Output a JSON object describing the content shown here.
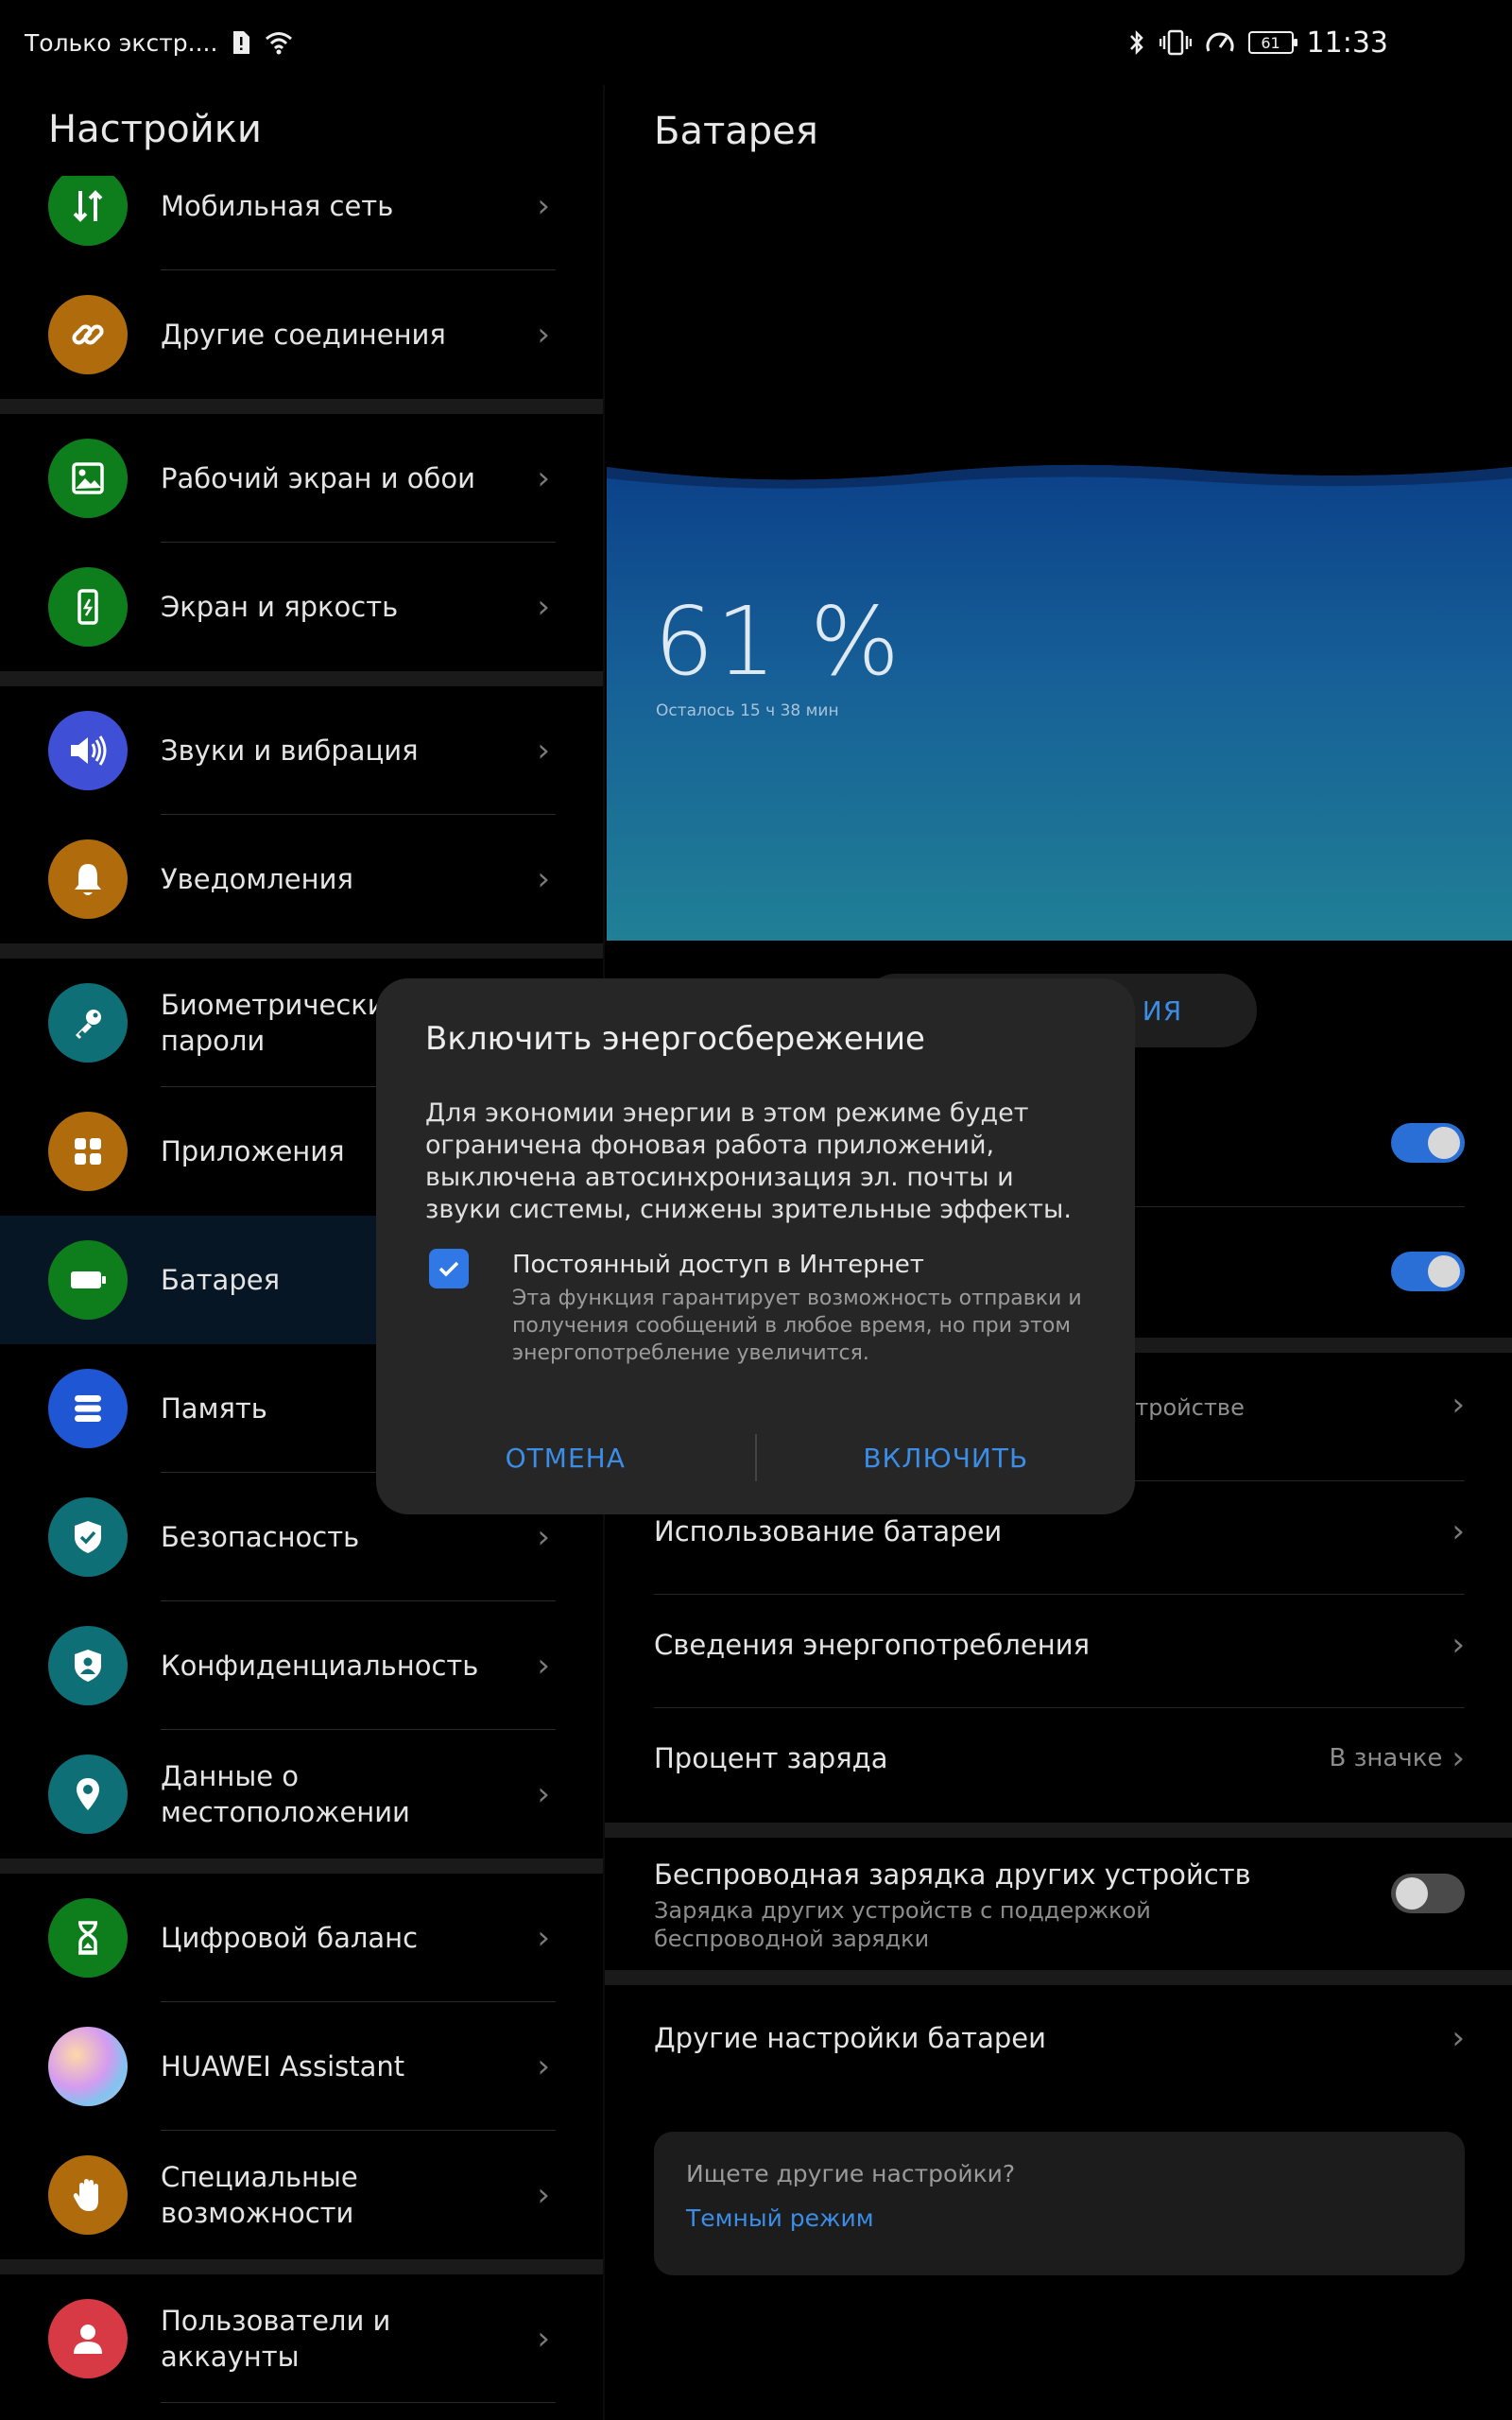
{
  "status": {
    "left_text": "Только экстр....",
    "time": "11:33",
    "battery_level": "61"
  },
  "settings": {
    "title": "Настройки",
    "items": [
      {
        "label": "Мобильная сеть",
        "icon": "mobile-data-icon",
        "color": "#0e7d1c"
      },
      {
        "label": "Другие соединения",
        "icon": "link-icon",
        "color": "#b06b0c"
      },
      {
        "label": "Рабочий экран и обои",
        "icon": "wallpaper-icon",
        "color": "#0e7d1c"
      },
      {
        "label": "Экран и яркость",
        "icon": "display-icon",
        "color": "#0e7d1c"
      },
      {
        "label": "Звуки и вибрация",
        "icon": "speaker-icon",
        "color": "#3f4fd6"
      },
      {
        "label": "Уведомления",
        "icon": "bell-icon",
        "color": "#b06b0c"
      },
      {
        "label": "Биометрические данные и пароли",
        "label_line1": "Биометрические",
        "label_line2": "пароли",
        "icon": "key-icon",
        "color": "#0f6f76"
      },
      {
        "label": "Приложения",
        "icon": "apps-grid-icon",
        "color": "#b06b0c"
      },
      {
        "label": "Батарея",
        "icon": "battery-icon",
        "color": "#0e7d1c"
      },
      {
        "label": "Память",
        "icon": "storage-icon",
        "color": "#1f56d4"
      },
      {
        "label": "Безопасность",
        "icon": "shield-check-icon",
        "color": "#0f6f76"
      },
      {
        "label": "Конфиденциальность",
        "icon": "privacy-shield-icon",
        "color": "#0f6f76"
      },
      {
        "label_line1": "Данные о",
        "label_line2": "местоположении",
        "icon": "location-pin-icon",
        "color": "#0f6f76"
      },
      {
        "label": "Цифровой баланс",
        "icon": "hourglass-icon",
        "color": "#0e7d1c"
      },
      {
        "label": "HUAWEI Assistant",
        "icon": "assistant-icon",
        "color": "rainbow"
      },
      {
        "label_line1": "Специальные",
        "label_line2": "возможности",
        "icon": "hand-icon",
        "color": "#b06b0c"
      },
      {
        "label": "Пользователи и аккаунты",
        "icon": "user-icon",
        "color": "#d73a44"
      }
    ]
  },
  "battery": {
    "title": "Батарея",
    "percent": "61 %",
    "percent_value": 61,
    "remaining": "Осталось 15 ч 38 мин",
    "mode_button_visible": "ИЯ",
    "optimize_sub_visible": "ий на устройстве",
    "rows": {
      "usage": "Использование батареи",
      "consumption": "Сведения энергопотребления",
      "charge_percent": "Процент заряда",
      "charge_percent_value": "В значке",
      "wireless_title": "Беспроводная зарядка других устройств",
      "wireless_sub": "Зарядка других устройств с поддержкой беспроводной зарядки",
      "other": "Другие настройки батареи"
    },
    "toggles": {
      "toggle1": true,
      "toggle2": true,
      "wireless": false
    },
    "search": {
      "question": "Ищете другие настройки?",
      "link": "Темный режим"
    }
  },
  "dialog": {
    "title": "Включить энергосбережение",
    "body": "Для экономии энергии в этом режиме будет ограничена фоновая работа приложений, выключена автосинхронизация эл. почты и звуки системы, снижены зрительные эффекты.",
    "checkbox_checked": true,
    "checkbox_title": "Постоянный доступ в Интернет",
    "checkbox_desc": "Эта функция гарантирует возможность отправки и получения сообщений в любое время, но при этом энергопотребление увеличится.",
    "cancel": "ОТМЕНА",
    "confirm": "ВКЛЮЧИТЬ"
  },
  "colors": {
    "accent": "#3b8de6",
    "toggle_on": "#2a6fd6",
    "dialog_bg": "#262626"
  }
}
